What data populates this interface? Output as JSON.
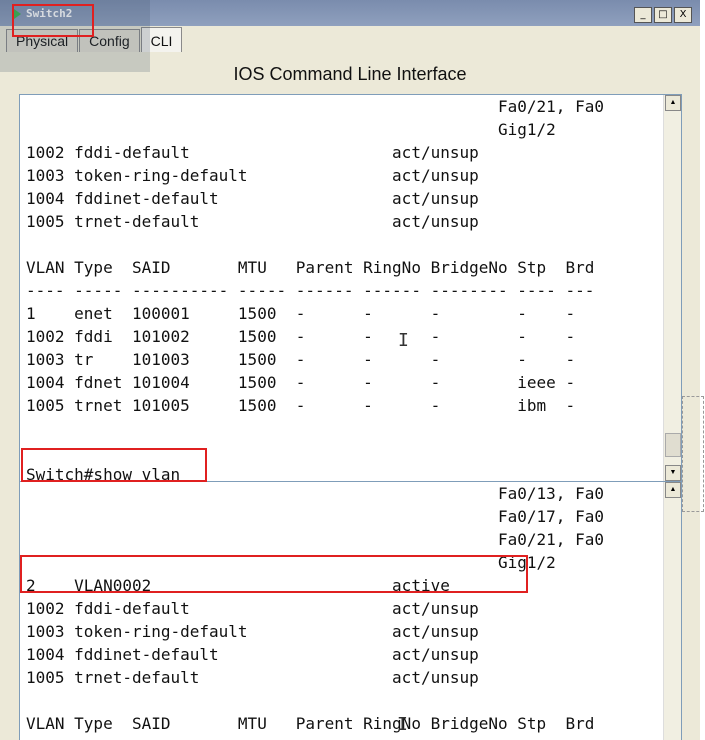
{
  "window": {
    "title": "Switch2",
    "buttons": [
      "_",
      "□",
      "X"
    ]
  },
  "tabs": [
    {
      "label": "Physical",
      "active": false
    },
    {
      "label": "Config",
      "active": false
    },
    {
      "label": "CLI",
      "active": true
    }
  ],
  "header": {
    "title": "IOS Command Line Interface"
  },
  "terminal_top": {
    "lines": [
      "                                                 Fa0/21, Fa0",
      "                                                 Gig1/2",
      "1002 fddi-default                     act/unsup",
      "1003 token-ring-default               act/unsup",
      "1004 fddinet-default                  act/unsup",
      "1005 trnet-default                    act/unsup",
      "",
      "VLAN Type  SAID       MTU   Parent RingNo BridgeNo Stp  Brd",
      "---- ----- ---------- ----- ------ ------ -------- ---- ---",
      "1    enet  100001     1500  -      -      -        -    -",
      "1002 fddi  101002     1500  -      -      -        -    -",
      "1003 tr    101003     1500  -      -      -        -    -",
      "1004 fdnet 101004     1500  -      -      -        ieee -",
      "1005 trnet 101005     1500  -      -      -        ibm  -",
      "",
      "",
      "Switch#show vlan"
    ]
  },
  "terminal_bottom": {
    "lines": [
      "                                                 Fa0/13, Fa0",
      "                                                 Fa0/17, Fa0",
      "                                                 Fa0/21, Fa0",
      "                                                 Gig1/2",
      "2    VLAN0002                         active",
      "1002 fddi-default                     act/unsup",
      "1003 token-ring-default               act/unsup",
      "1004 fddinet-default                  act/unsup",
      "1005 trnet-default                    act/unsup",
      "",
      "VLAN Type  SAID       MTU   Parent RingNo BridgeNo Stp  Brd",
      "---- ----- ---------- ----- ------ ------ -------- ---- ---"
    ]
  },
  "colors": {
    "highlight": "#e02020",
    "titlebar": "#7a8cad"
  }
}
